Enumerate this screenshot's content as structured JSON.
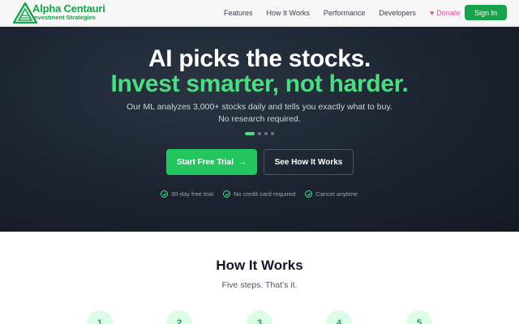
{
  "nav": {
    "brand_name": "Alpha Centauri",
    "brand_tagline": "Investment Strategies",
    "links": [
      "Features",
      "How It Works",
      "Performance",
      "Developers"
    ],
    "donate": "Donate",
    "signin": "Sign In"
  },
  "hero": {
    "title_line1": "AI picks the stocks.",
    "title_line2": "Invest smarter, not harder.",
    "subtitle": "Our ML analyzes 3,000+ stocks daily and tells you exactly what to buy. No research required.",
    "primary_cta": "Start Free Trial",
    "secondary_cta": "See How It Works",
    "perks": [
      "30-day free trial",
      "No credit card required",
      "Cancel anytime"
    ]
  },
  "how": {
    "title": "How It Works",
    "subtitle": "Five steps. That's it.",
    "steps": [
      "1",
      "2",
      "3",
      "4",
      "5"
    ]
  },
  "colors": {
    "brand_green": "#16a34a",
    "accent_green": "#4ade80",
    "donate_pink": "#ec4899",
    "hero_bg": "#1b2330"
  },
  "icons": {
    "logo": "triangle-logo-icon",
    "donate": "heart-icon",
    "cta": "arrow-right-icon",
    "perk": "check-circle-icon"
  }
}
